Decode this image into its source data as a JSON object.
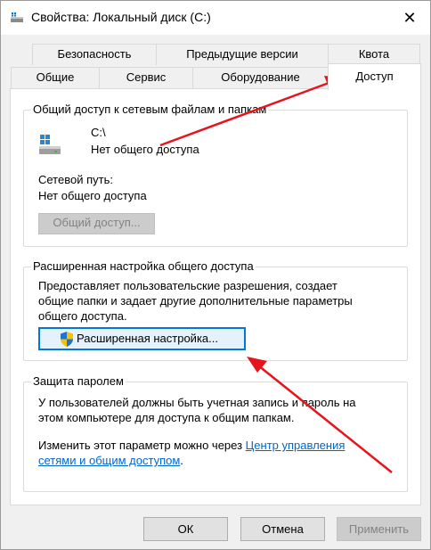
{
  "window": {
    "title": "Свойства: Локальный диск (C:)",
    "close_glyph": "✕"
  },
  "tabs": {
    "row1": [
      "Безопасность",
      "Предыдущие версии",
      "Квота"
    ],
    "row2": [
      "Общие",
      "Сервис",
      "Оборудование",
      "Доступ"
    ],
    "active": "Доступ"
  },
  "share_group": {
    "legend": "Общий доступ к сетевым файлам и папкам",
    "path": "C:\\",
    "status": "Нет общего доступа",
    "network_path_label": "Сетевой путь:",
    "network_path_value": "Нет общего доступа",
    "share_button": "Общий доступ..."
  },
  "advanced_group": {
    "legend": "Расширенная настройка общего доступа",
    "description_lines": [
      "Предоставляет пользовательские разрешения, создает",
      "общие папки и задает другие дополнительные параметры",
      "общего доступа."
    ],
    "advanced_button": "Расширенная настройка..."
  },
  "password_group": {
    "legend": "Защита паролем",
    "line1": "У пользователей должны быть учетная запись и пароль на",
    "line2": "этом компьютере для доступа к общим папкам.",
    "line3_prefix": "Изменить этот параметр можно через ",
    "link_part1": "Центр управления",
    "link_part2": "сетями и общим доступом",
    "line4_suffix": "."
  },
  "footer": {
    "ok": "ОК",
    "cancel": "Отмена",
    "apply": "Применить"
  },
  "colors": {
    "arrow": "#e8141b",
    "link": "#0066cc",
    "accent": "#0078d7"
  },
  "icons": {
    "drive": "windows-drive-icon",
    "shield": "uac-shield-icon"
  }
}
